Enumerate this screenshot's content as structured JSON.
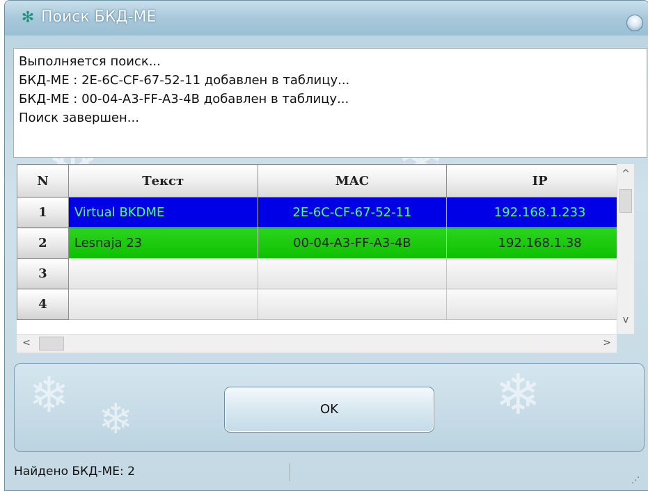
{
  "window": {
    "title": "Поиск БКД-МЕ",
    "title_icon": "snowflake-icon",
    "close_icon": "close-orb-icon"
  },
  "log": {
    "lines": [
      "Выполняется поиск...",
      "БКД-МЕ : 2E-6C-CF-67-52-11 добавлен в таблицу...",
      "БКД-МЕ : 00-04-A3-FF-A3-4B добавлен в таблицу...",
      "Поиск завершен..."
    ]
  },
  "table": {
    "columns": [
      "N",
      "Текст",
      "MAC",
      "IP"
    ],
    "rows": [
      {
        "n": "1",
        "text": "Virtual BKDME",
        "mac": "2E-6C-CF-67-52-11",
        "ip": "192.168.1.233",
        "state": "selected"
      },
      {
        "n": "2",
        "text": "Lesnaja 23",
        "mac": "00-04-A3-FF-A3-4B",
        "ip": "192.168.1.38",
        "state": "green"
      },
      {
        "n": "3",
        "text": "",
        "mac": "",
        "ip": "",
        "state": "empty"
      },
      {
        "n": "4",
        "text": "",
        "mac": "",
        "ip": "",
        "state": "empty"
      }
    ]
  },
  "scroll": {
    "up": "^",
    "down": "v",
    "left": "<",
    "right": ">"
  },
  "buttons": {
    "ok": "OK"
  },
  "status": {
    "found_text": "Найдено БКД-МЕ: 2"
  },
  "colors": {
    "selected_row_bg": "#0000e6",
    "selected_row_text": "#4dff88",
    "green_row_bg": "#0ec000"
  }
}
